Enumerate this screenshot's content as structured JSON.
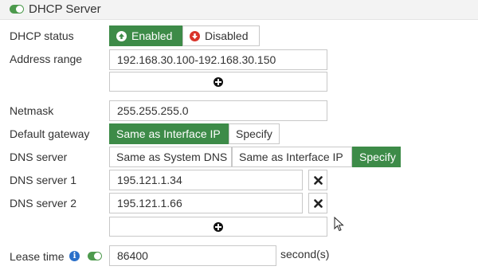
{
  "section": {
    "title": "DHCP Server",
    "enabled": true
  },
  "fields": {
    "dhcp_status": {
      "label": "DHCP status",
      "options": [
        "Enabled",
        "Disabled"
      ],
      "selected": "Enabled"
    },
    "address_range": {
      "label": "Address range",
      "value": "192.168.30.100-192.168.30.150"
    },
    "netmask": {
      "label": "Netmask",
      "value": "255.255.255.0"
    },
    "default_gateway": {
      "label": "Default gateway",
      "options": [
        "Same as Interface IP",
        "Specify"
      ],
      "selected": "Same as Interface IP"
    },
    "dns_server": {
      "label": "DNS server",
      "options": [
        "Same as System DNS",
        "Same as Interface IP",
        "Specify"
      ],
      "selected": "Specify"
    },
    "dns_server_1": {
      "label": "DNS server 1",
      "value": "195.121.1.34"
    },
    "dns_server_2": {
      "label": "DNS server 2",
      "value": "195.121.1.66"
    },
    "lease_time": {
      "label": "Lease time",
      "value": "86400",
      "unit": "second(s)",
      "toggle_on": true
    }
  },
  "colors": {
    "accent_green": "#3d8b48",
    "danger_red": "#d9342b",
    "info_blue": "#2a6fc9"
  },
  "icons": [
    "toggle-switch-icon",
    "arrow-up-circle-icon",
    "arrow-down-circle-icon",
    "plus-circle-icon",
    "close-icon",
    "info-icon",
    "mouse-cursor-icon"
  ]
}
